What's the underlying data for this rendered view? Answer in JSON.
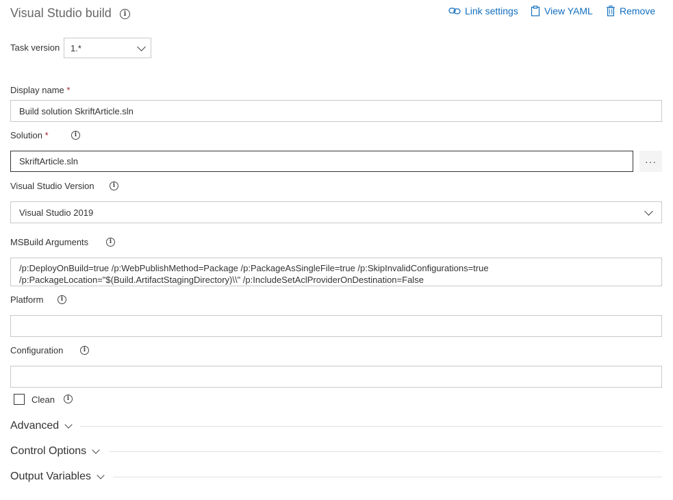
{
  "header": {
    "title": "Visual Studio build",
    "link_settings": "Link settings",
    "view_yaml": "View YAML",
    "remove": "Remove"
  },
  "task_version": {
    "label": "Task version",
    "value": "1.*"
  },
  "display_name": {
    "label": "Display name",
    "required": "*",
    "value": "Build solution SkriftArticle.sln"
  },
  "solution": {
    "label": "Solution",
    "required": "*",
    "value": "SkriftArticle.sln",
    "browse": "···"
  },
  "vs_version": {
    "label": "Visual Studio Version",
    "value": "Visual Studio 2019"
  },
  "msbuild": {
    "label": "MSBuild Arguments",
    "line1": "/p:DeployOnBuild=true /p:WebPublishMethod=Package /p:PackageAsSingleFile=true /p:SkipInvalidConfigurations=true",
    "line2": "/p:PackageLocation=\"$(Build.ArtifactStagingDirectory)\\\\\" /p:IncludeSetAclProviderOnDestination=False"
  },
  "platform": {
    "label": "Platform",
    "value": ""
  },
  "configuration": {
    "label": "Configuration",
    "value": ""
  },
  "clean": {
    "label": "Clean",
    "checked": false
  },
  "sections": {
    "advanced": "Advanced",
    "control_options": "Control Options",
    "output_variables": "Output Variables"
  },
  "colors": {
    "link": "#106ebe",
    "required": "#a4262c",
    "border": "#c8c8c8"
  },
  "icons": {
    "info": "info-icon",
    "link": "link-icon",
    "yaml": "clipboard-icon",
    "remove": "trash-icon"
  }
}
